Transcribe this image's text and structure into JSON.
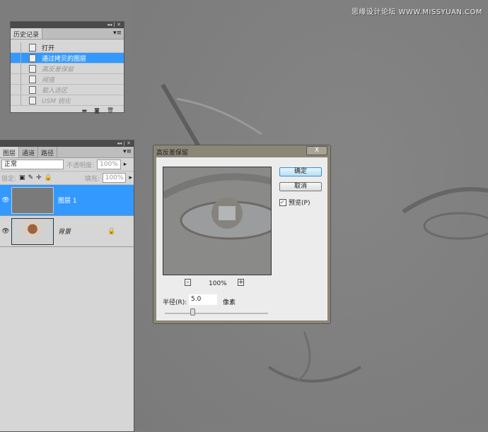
{
  "watermark": "思缘设计论坛 WWW.MISSYUAN.COM",
  "history": {
    "tab": "历史记录",
    "items": [
      {
        "label": "打开",
        "state": "normal"
      },
      {
        "label": "通过拷贝的图层",
        "state": "selected"
      },
      {
        "label": "高反差保留",
        "state": "dimmed"
      },
      {
        "label": "阈值",
        "state": "dimmed"
      },
      {
        "label": "载入选区",
        "state": "dimmed"
      },
      {
        "label": "USM 锐化",
        "state": "dimmed"
      }
    ]
  },
  "layers": {
    "tabs": [
      "图层",
      "通道",
      "路径"
    ],
    "blend_mode": "正常",
    "opacity_label": "不透明度:",
    "opacity": "100%",
    "lock_label": "锁定:",
    "fill_label": "填充:",
    "fill": "100%",
    "items": [
      {
        "name": "图层 1",
        "selected": true
      },
      {
        "name": "背景",
        "selected": false,
        "locked": true
      }
    ]
  },
  "dialog": {
    "title": "高反差保留",
    "close": "X",
    "ok": "确定",
    "cancel": "取消",
    "preview_label": "预览(P)",
    "preview_checked": true,
    "zoom": "100%",
    "zoom_out": "-",
    "zoom_in": "+",
    "radius_label": "半径(R):",
    "radius": "5.0",
    "unit": "像素",
    "slider_fraction": 0.27
  }
}
